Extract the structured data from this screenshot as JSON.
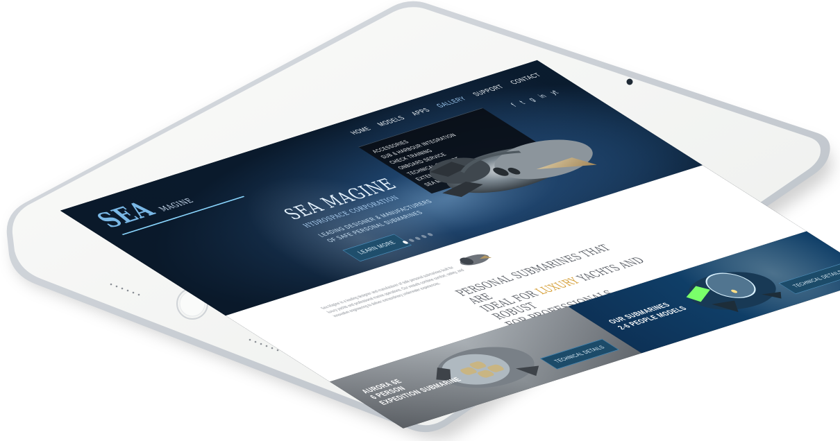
{
  "site": {
    "logo_main": "SEA",
    "logo_sub": "MAGINE",
    "nav": [
      "HOME",
      "MODELS",
      "APPS",
      "GALLERY",
      "SUPPORT",
      "CONTACT"
    ],
    "submenu": [
      "ACCESSORIES",
      "SUB & HARBOUR INTEGRATION",
      "CHECK TRAINING",
      "ONBOARD SERVICE",
      "TECHNICAL SUPPORT",
      "EXTENDED WARRANTY",
      "SEA MAGINE RESORTS"
    ],
    "social_icons": [
      "f",
      "t",
      "g",
      "in",
      "yt"
    ]
  },
  "hero": {
    "brand": "SEA MAGINE",
    "tagline": "HYDROSPACE CORPORATION",
    "lines": [
      "LEADING DESIGNER & MANUFACTURERS",
      "OF SAFE PERSONAL SUBMARINES"
    ],
    "button": "LEARN MORE",
    "dots": [
      "",
      "",
      "",
      "",
      ""
    ]
  },
  "intro": {
    "body": "Sea Magine is a leading designer and manufacturer of safe personal submarines built for luxury yachts and professional marine operations. Our vessels combine comfort, safety, and innovative engineering to deliver extraordinary underwater experiences.",
    "heading_1": "PERSONAL SUBMARINES THAT ARE",
    "heading_2_prefix": "IDEAL FOR ",
    "heading_2_highlight": "LUXURY",
    "heading_2_suffix": " YACHTS AND ROBUST",
    "heading_3": "FOR PROFESSIONALS"
  },
  "panels": {
    "left": {
      "caption_1": "AURORA 6E",
      "caption_2": "6 PERSON",
      "caption_3": "EXPEDITION SUBMARINE",
      "button": "TECHNICAL DETAILS"
    },
    "right": {
      "caption_1": "OUR SUBMARINES",
      "caption_2": "2-6 PEOPLE MODELS",
      "button": "TECHNICAL DETAILS"
    }
  },
  "colors": {
    "tablet_frame": "#f3f4f2",
    "frame_edge": "#d8dbdf",
    "screen_bg": "#0b1119",
    "accent": "#8bd7ff",
    "button": "#1f4e6c",
    "highlight": "#d39a2d"
  },
  "icons": {
    "camera": "camera-icon",
    "home_button": "home-button-icon",
    "speaker_grill": "speaker-grill-icon"
  }
}
